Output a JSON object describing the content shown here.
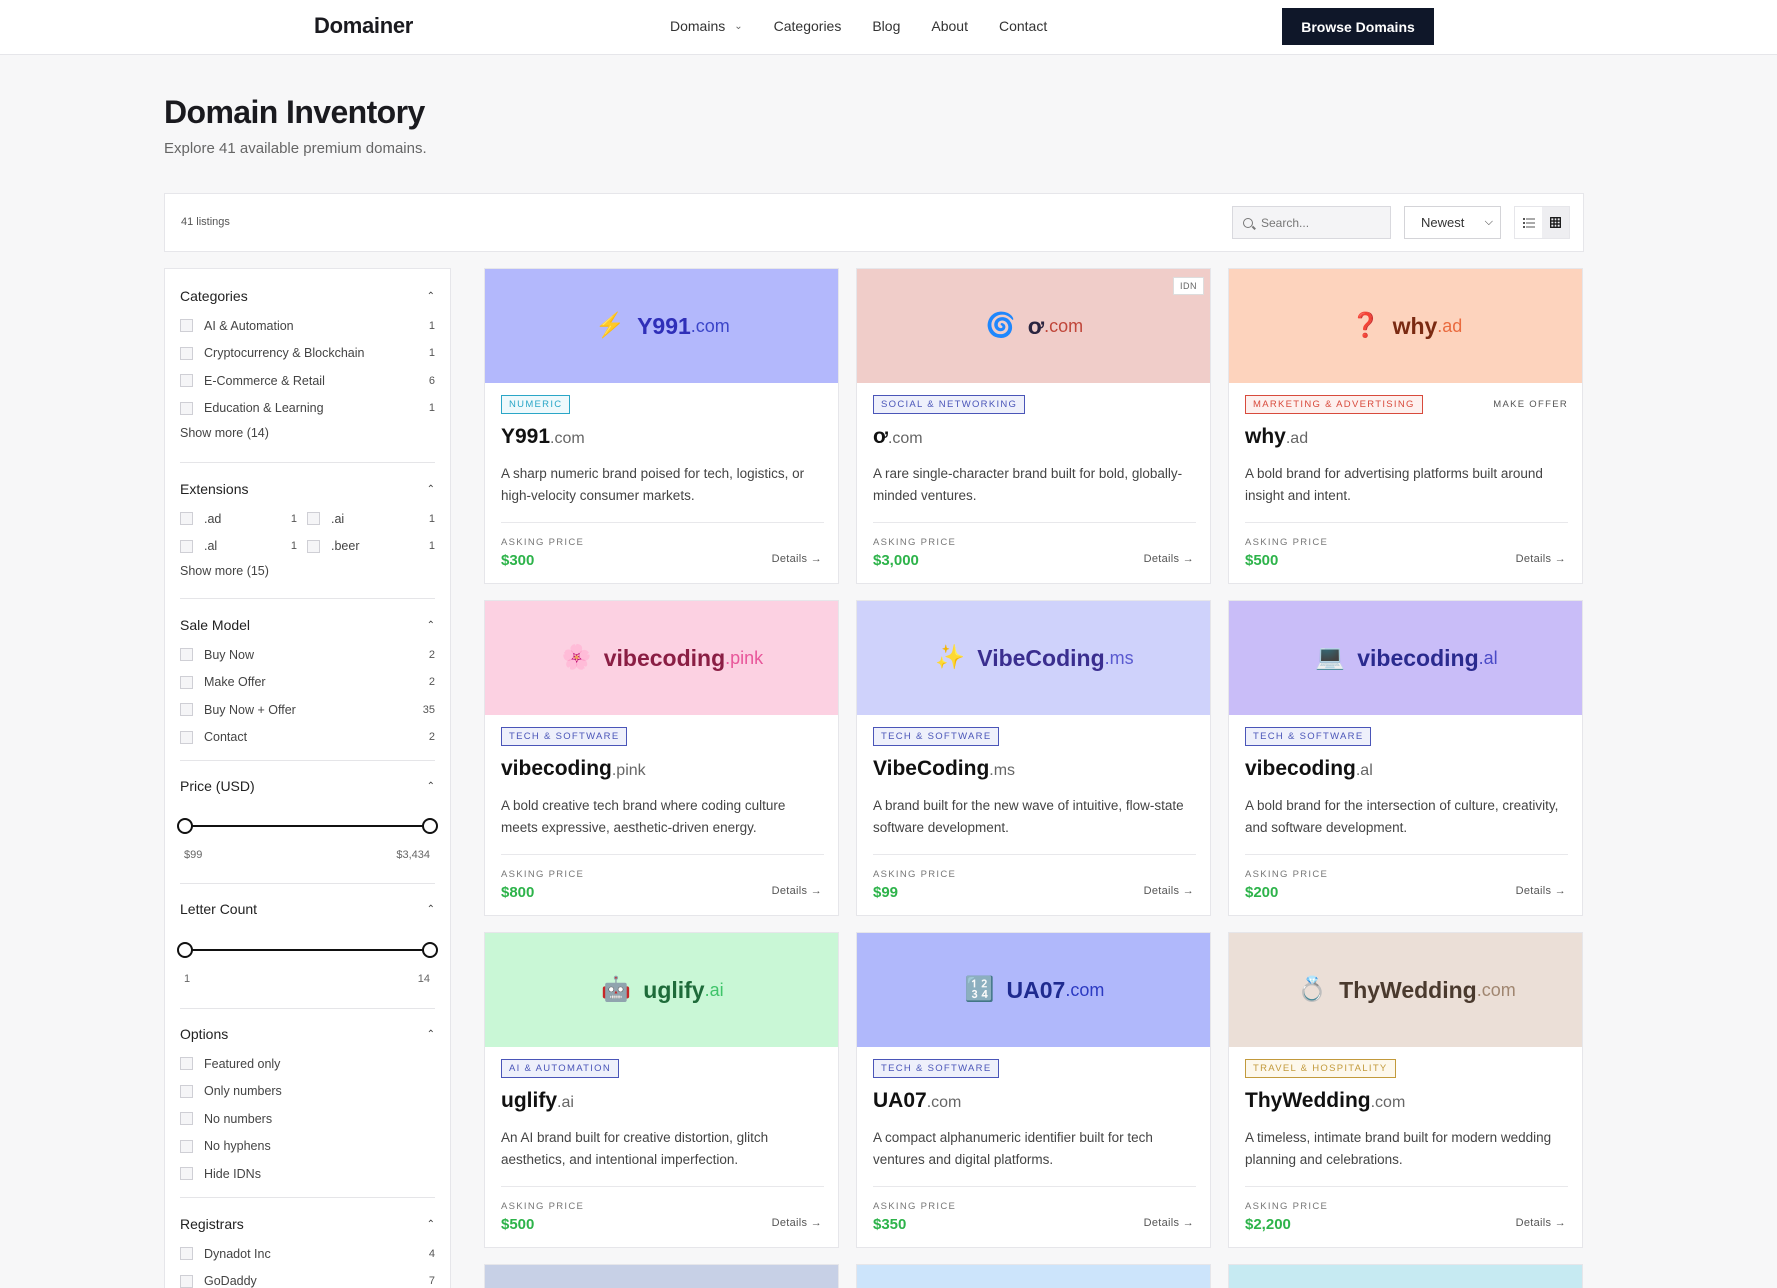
{
  "header": {
    "logo": "Domainer",
    "nav": [
      {
        "label": "Domains",
        "has_dropdown": true
      },
      {
        "label": "Categories"
      },
      {
        "label": "Blog"
      },
      {
        "label": "About"
      },
      {
        "label": "Contact"
      }
    ],
    "cta_label": "Browse Domains"
  },
  "page": {
    "title": "Domain Inventory",
    "subtitle": "Explore 41 available premium domains."
  },
  "toolbar": {
    "count_label": "41 listings",
    "search_placeholder": "Search...",
    "sort_value": "Newest",
    "views": [
      {
        "icon": "list-view-icon",
        "active": false
      },
      {
        "icon": "grid-view-icon",
        "active": true
      }
    ]
  },
  "filters": {
    "categories": {
      "title": "Categories",
      "items": [
        {
          "label": "AI & Automation",
          "count": "1"
        },
        {
          "label": "Cryptocurrency & Blockchain",
          "count": "1"
        },
        {
          "label": "E-Commerce & Retail",
          "count": "6"
        },
        {
          "label": "Education & Learning",
          "count": "1"
        }
      ],
      "show_more": "Show more (14)"
    },
    "extensions": {
      "title": "Extensions",
      "items": [
        {
          "label": ".ad",
          "count": "1"
        },
        {
          "label": ".ai",
          "count": "1"
        },
        {
          "label": ".al",
          "count": "1"
        },
        {
          "label": ".beer",
          "count": "1"
        }
      ],
      "show_more": "Show more (15)"
    },
    "sale_model": {
      "title": "Sale Model",
      "items": [
        {
          "label": "Buy Now",
          "count": "2"
        },
        {
          "label": "Make Offer",
          "count": "2"
        },
        {
          "label": "Buy Now + Offer",
          "count": "35"
        },
        {
          "label": "Contact",
          "count": "2"
        }
      ]
    },
    "price": {
      "title": "Price (USD)",
      "min_label": "$99",
      "max_label": "$3,434"
    },
    "letter_count": {
      "title": "Letter Count",
      "min_label": "1",
      "max_label": "14"
    },
    "options": {
      "title": "Options",
      "items": [
        {
          "label": "Featured only"
        },
        {
          "label": "Only numbers"
        },
        {
          "label": "No numbers"
        },
        {
          "label": "No hyphens"
        },
        {
          "label": "Hide IDNs"
        }
      ]
    },
    "registrars": {
      "title": "Registrars",
      "items": [
        {
          "label": "Dynadot Inc",
          "count": "4"
        },
        {
          "label": "GoDaddy",
          "count": "7"
        }
      ]
    }
  },
  "cards": [
    {
      "icon": "⚡",
      "icon_name": "lightning-icon",
      "name": "Y991",
      "ext": ".com",
      "banner_bg": "#b3b8fc",
      "name_color": "#2f2fb8",
      "ext_color": "#3b45c9",
      "idn": "",
      "tag": "NUMERIC",
      "tag_color": "#2aa6c7",
      "tag_bg": "#eef9fc",
      "offer": "",
      "desc": "A sharp numeric brand poised for tech, logistics, or high-velocity consumer markets.",
      "price_label": "ASKING PRICE",
      "price": "$300",
      "details": "Details →"
    },
    {
      "icon": "🌀",
      "icon_name": "spiral-icon",
      "name": "ơ",
      "ext": ".com",
      "banner_bg": "#f0cdc9",
      "name_color": "#2a2540",
      "ext_color": "#c0463a",
      "idn": "IDN",
      "tag": "SOCIAL & NETWORKING",
      "tag_color": "#4a55b8",
      "tag_bg": "#eef0fb",
      "offer": "",
      "desc": "A rare single-character brand built for bold, globally-minded ventures.",
      "price_label": "ASKING PRICE",
      "price": "$3,000",
      "details": "Details →"
    },
    {
      "icon": "❓",
      "icon_name": "question-mark-icon",
      "name": "why",
      "ext": ".ad",
      "banner_bg": "#fdd3bd",
      "name_color": "#7a2a12",
      "ext_color": "#ea6a3e",
      "idn": "",
      "tag": "MARKETING & ADVERTISING",
      "tag_color": "#d84a3c",
      "tag_bg": "#fdf0ee",
      "offer": "MAKE OFFER",
      "desc": "A bold brand for advertising platforms built around insight and intent.",
      "price_label": "ASKING PRICE",
      "price": "$500",
      "details": "Details →"
    },
    {
      "icon": "🌸",
      "icon_name": "flower-icon",
      "name": "vibecoding",
      "ext": ".pink",
      "banner_bg": "#fcd1e2",
      "name_color": "#8a1e44",
      "ext_color": "#e8569a",
      "idn": "",
      "tag": "TECH & SOFTWARE",
      "tag_color": "#4a55b8",
      "tag_bg": "#eef0fb",
      "offer": "",
      "desc": "A bold creative tech brand where coding culture meets expressive, aesthetic-driven energy.",
      "price_label": "ASKING PRICE",
      "price": "$800",
      "details": "Details →"
    },
    {
      "icon": "✨",
      "icon_name": "sparkles-icon",
      "name": "VibeCoding",
      "ext": ".ms",
      "banner_bg": "#cfd2fb",
      "name_color": "#3a2e8f",
      "ext_color": "#5a5ad0",
      "idn": "",
      "tag": "TECH & SOFTWARE",
      "tag_color": "#4a55b8",
      "tag_bg": "#eef0fb",
      "offer": "",
      "desc": "A brand built for the new wave of intuitive, flow-state software development.",
      "price_label": "ASKING PRICE",
      "price": "$99",
      "details": "Details →"
    },
    {
      "icon": "💻",
      "icon_name": "computer-icon",
      "name": "vibecoding",
      "ext": ".al",
      "banner_bg": "#c9bdf8",
      "name_color": "#2a2a8e",
      "ext_color": "#4a4ac7",
      "idn": "",
      "tag": "TECH & SOFTWARE",
      "tag_color": "#4a55b8",
      "tag_bg": "#eef0fb",
      "offer": "",
      "desc": "A bold brand for the intersection of culture, creativity, and software development.",
      "price_label": "ASKING PRICE",
      "price": "$200",
      "details": "Details →"
    },
    {
      "icon": "🤖",
      "icon_name": "robot-icon",
      "name": "uglify",
      "ext": ".ai",
      "banner_bg": "#c9f7d6",
      "name_color": "#1e6b3a",
      "ext_color": "#3fc46a",
      "idn": "",
      "tag": "AI & AUTOMATION",
      "tag_color": "#4a55b8",
      "tag_bg": "#eef0fb",
      "offer": "",
      "desc": "An AI brand built for creative distortion, glitch aesthetics, and intentional imperfection.",
      "price_label": "ASKING PRICE",
      "price": "$500",
      "details": "Details →"
    },
    {
      "icon": "🔢",
      "icon_name": "numbers-icon",
      "name": "UA07",
      "ext": ".com",
      "banner_bg": "#b0b8fb",
      "name_color": "#1e2a8f",
      "ext_color": "#2c3ac2",
      "idn": "",
      "tag": "TECH & SOFTWARE",
      "tag_color": "#4a55b8",
      "tag_bg": "#eef0fb",
      "offer": "",
      "desc": "A compact alphanumeric identifier built for tech ventures and digital platforms.",
      "price_label": "ASKING PRICE",
      "price": "$350",
      "details": "Details →"
    },
    {
      "icon": "💍",
      "icon_name": "ring-icon",
      "name": "ThyWedding",
      "ext": ".com",
      "banner_bg": "#ebdfd7",
      "name_color": "#4a3a2e",
      "ext_color": "#a08670",
      "idn": "",
      "tag": "TRAVEL & HOSPITALITY",
      "tag_color": "#c29a3c",
      "tag_bg": "#fdf8ec",
      "offer": "",
      "desc": "A timeless, intimate brand built for modern wedding planning and celebrations.",
      "price_label": "ASKING PRICE",
      "price": "$2,200",
      "details": "Details →"
    }
  ],
  "next_row_banners": [
    "#c7d0e6",
    "#cce4fb",
    "#c6eaf2"
  ]
}
